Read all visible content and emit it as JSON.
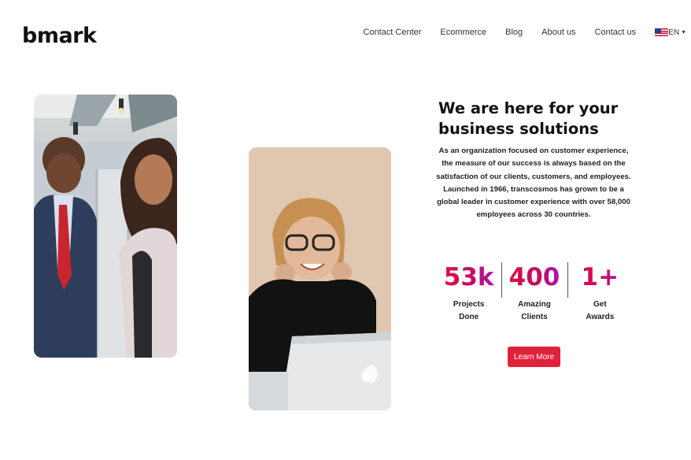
{
  "brand": {
    "logo": "bmark"
  },
  "nav": {
    "items": [
      {
        "label": "Contact Center"
      },
      {
        "label": "Ecommerce"
      },
      {
        "label": "Blog"
      },
      {
        "label": "About us"
      },
      {
        "label": "Contact us"
      }
    ],
    "language": "EN"
  },
  "hero": {
    "title_line1": "We are here for your",
    "title_line2": "business solutions",
    "description": "As an organization focused on customer experience, the measure of our success is always based on the satisfaction of our clients, customers, and employees. Launched in 1966, transcosmos has grown to be a global leader in customer experience with over 58,000 employees across 30 countries.",
    "stats": [
      {
        "value": "53k",
        "label_line1": "Projects",
        "label_line2": "Done"
      },
      {
        "value": "400",
        "label_line1": "Amazing",
        "label_line2": "Clients"
      },
      {
        "value": "1+",
        "label_line1": "Get",
        "label_line2": "Awards"
      }
    ],
    "cta_label": "Learn More"
  },
  "colors": {
    "accent": "#e2213b",
    "gradient_start": "#e4113b",
    "gradient_end": "#a21cc4"
  },
  "icons": [
    "us-flag-icon",
    "caret-down-icon"
  ]
}
